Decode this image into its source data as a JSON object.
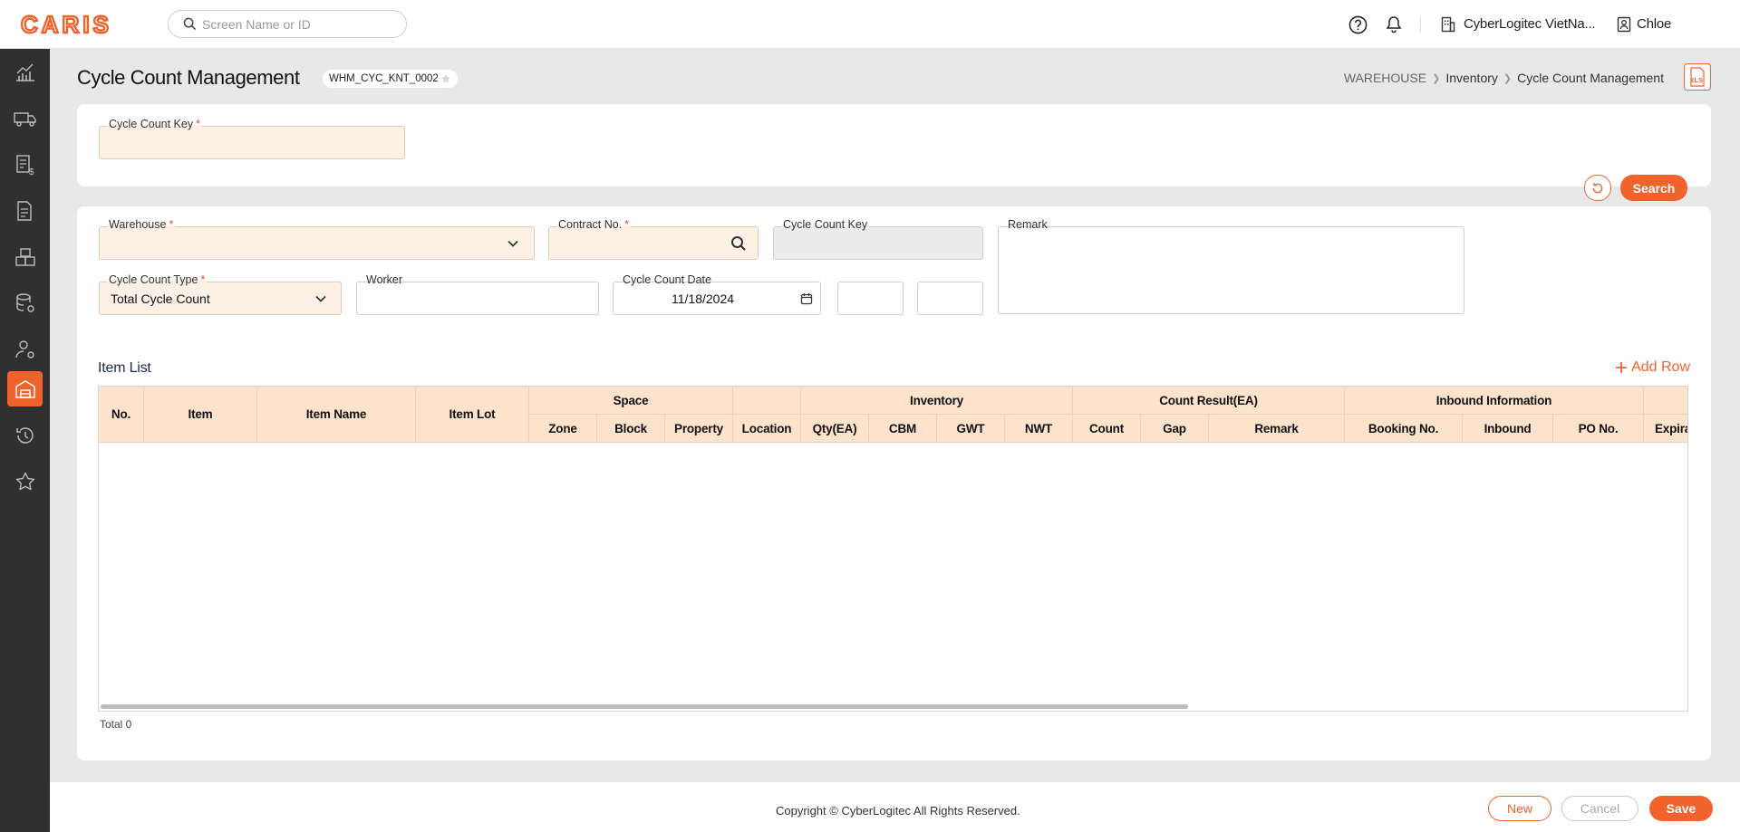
{
  "header": {
    "logo_text": "CARIS",
    "search_placeholder": "Screen Name or ID",
    "company": "CyberLogitec VietNa...",
    "user": "Chloe"
  },
  "sidebar": {
    "items": [
      {
        "icon": "chart-icon",
        "active": false
      },
      {
        "icon": "truck-icon",
        "active": false
      },
      {
        "icon": "invoice-icon",
        "active": false
      },
      {
        "icon": "document-icon",
        "active": false
      },
      {
        "icon": "boxes-icon",
        "active": false
      },
      {
        "icon": "database-settings-icon",
        "active": false
      },
      {
        "icon": "user-settings-icon",
        "active": false
      },
      {
        "icon": "warehouse-icon",
        "active": true
      },
      {
        "icon": "history-icon",
        "active": false
      },
      {
        "icon": "star-icon",
        "active": false
      }
    ]
  },
  "page": {
    "title": "Cycle Count Management",
    "screen_id": "WHM_CYC_KNT_0002",
    "breadcrumb": [
      "WAREHOUSE",
      "Inventory",
      "Cycle Count Management"
    ]
  },
  "search_panel": {
    "cycle_count_key_label": "Cycle Count Key",
    "search_button": "Search"
  },
  "form": {
    "warehouse_label": "Warehouse",
    "contract_no_label": "Contract No.",
    "cycle_count_key_label": "Cycle Count Key",
    "remark_label": "Remark",
    "cycle_count_type_label": "Cycle Count Type",
    "cycle_count_type_value": "Total Cycle Count",
    "worker_label": "Worker",
    "cycle_count_date_label": "Cycle Count Date",
    "cycle_count_date_value": "11/18/2024"
  },
  "item_list": {
    "title": "Item List",
    "add_row": "Add Row",
    "group_headers": [
      "Space",
      "Inventory",
      "Count Result(EA)",
      "Inbound Information"
    ],
    "columns": [
      "No.",
      "Item",
      "Item Name",
      "Item Lot",
      "Zone",
      "Block",
      "Property",
      "Location",
      "Qty(EA)",
      "CBM",
      "GWT",
      "NWT",
      "Count",
      "Gap",
      "Remark",
      "Booking No.",
      "Inbound",
      "PO No.",
      "Expira"
    ],
    "rows": [],
    "total": "Total 0"
  },
  "footer": {
    "copyright": "Copyright © CyberLogitec All Rights Reserved.",
    "new_button": "New",
    "cancel_button": "Cancel",
    "save_button": "Save"
  },
  "colors": {
    "accent": "#f2622c",
    "required_bg": "#fdf1e6",
    "header_bg": "#fde3cc",
    "sidebar_bg": "#303030"
  }
}
